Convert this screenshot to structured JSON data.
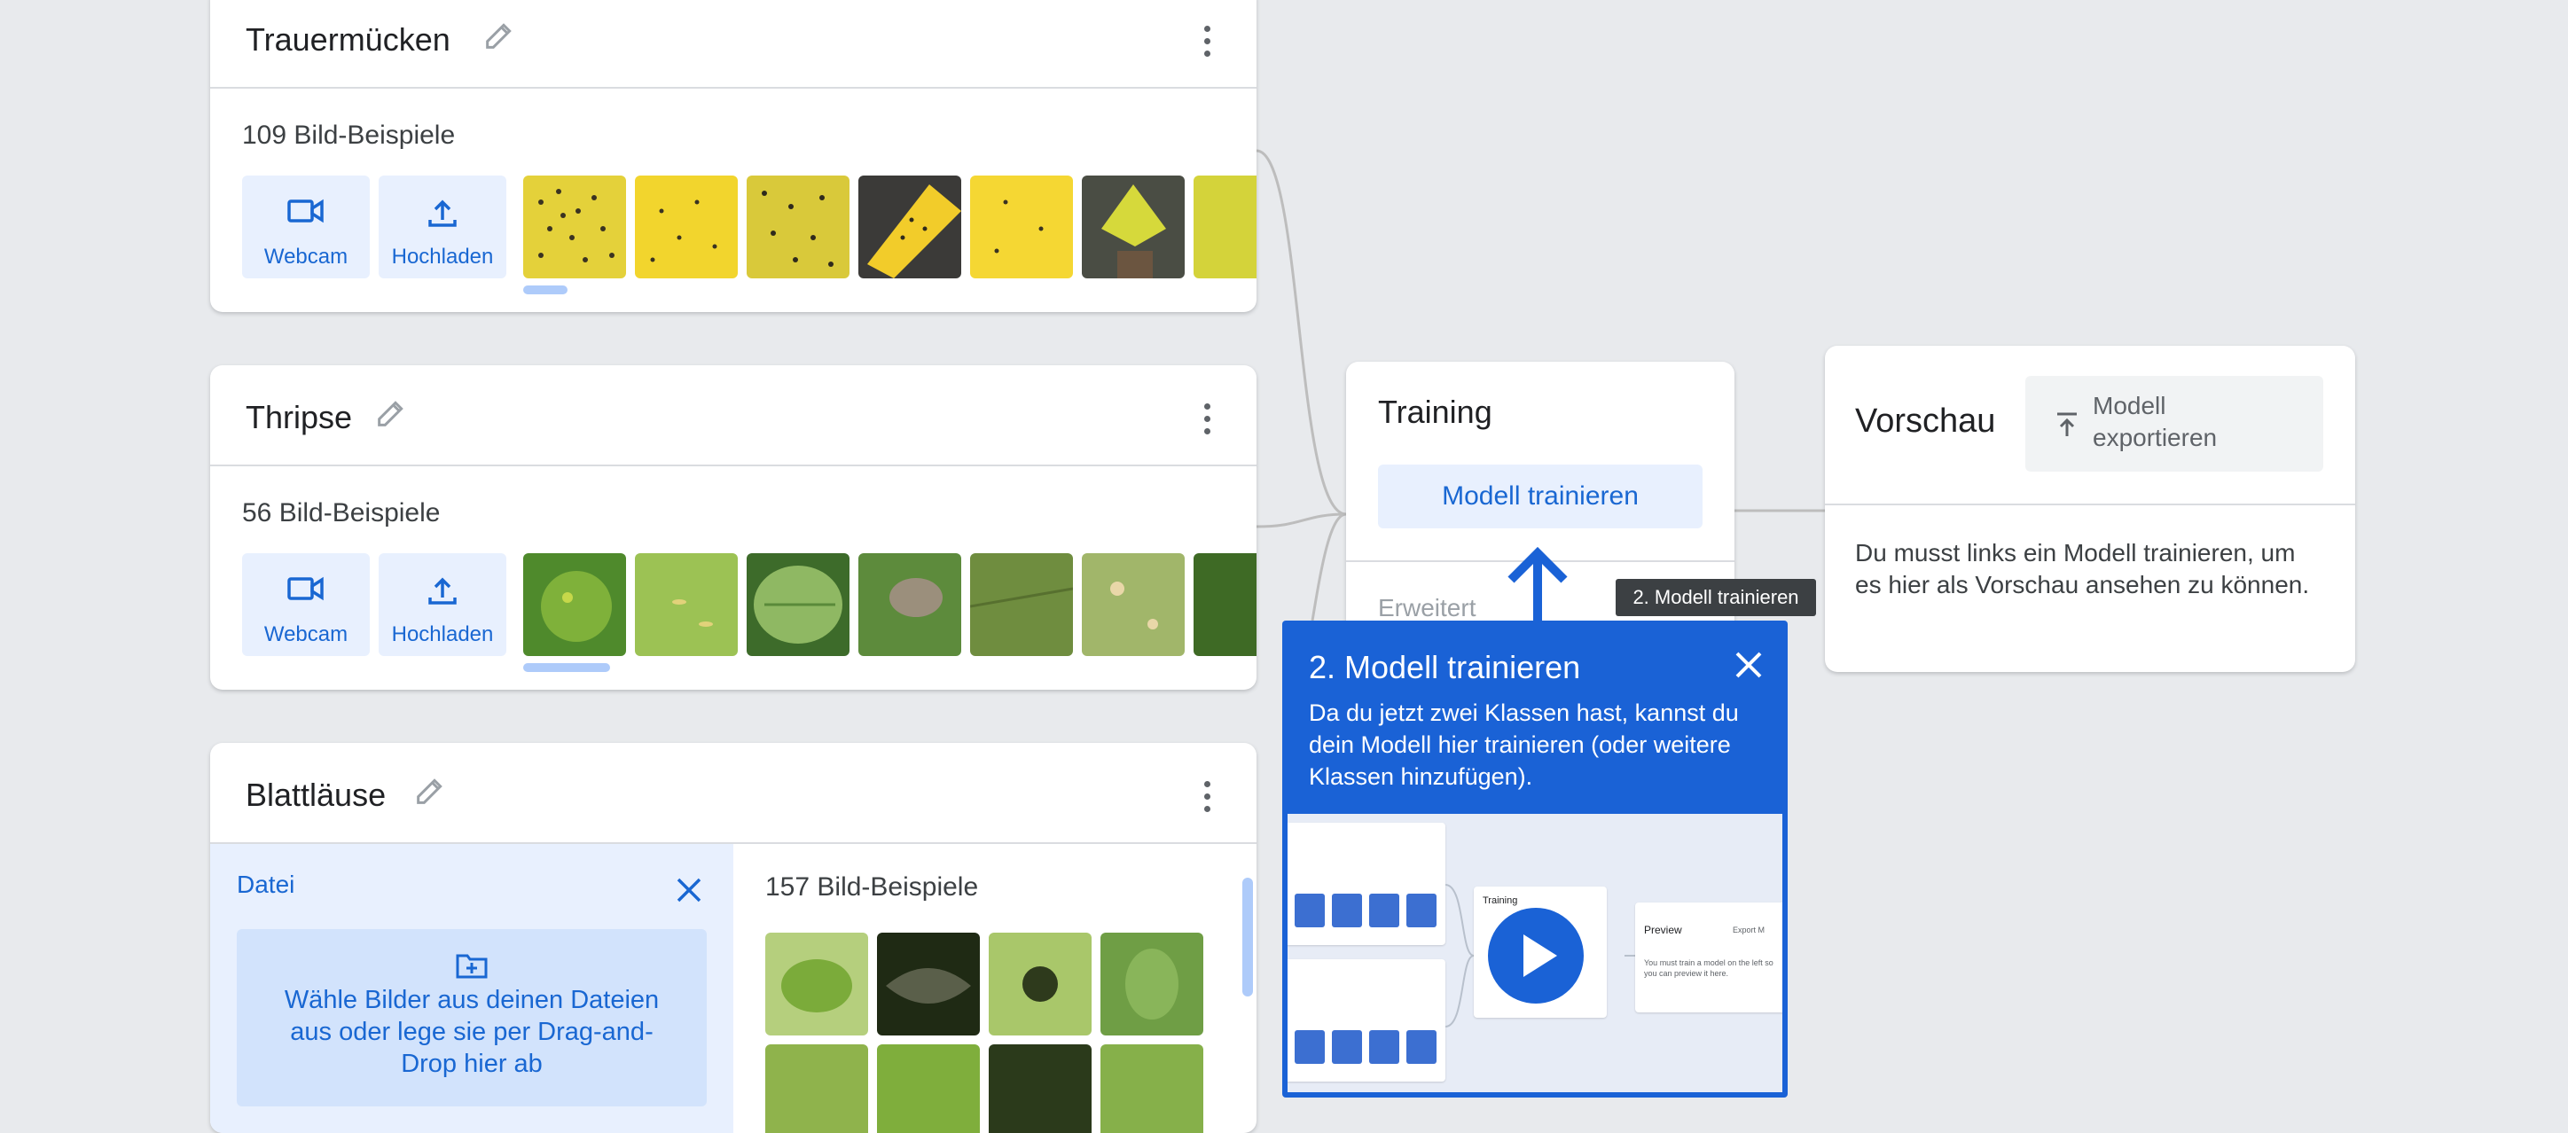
{
  "classes": [
    {
      "name": "Trauermücken",
      "count_label": "109 Bild-Beispiele",
      "webcam_label": "Webcam",
      "upload_label": "Hochladen"
    },
    {
      "name": "Thripse",
      "count_label": "56 Bild-Beispiele",
      "webcam_label": "Webcam",
      "upload_label": "Hochladen"
    },
    {
      "name": "Blattläuse",
      "count_label": "157 Bild-Beispiele",
      "upload_panel": {
        "title": "Datei",
        "dropzone_text": "Wähle Bilder aus deinen Dateien aus oder lege sie per Drag-and-Drop hier ab"
      }
    }
  ],
  "training": {
    "title": "Training",
    "train_button": "Modell trainieren",
    "advanced_label": "Erweitert"
  },
  "preview": {
    "title": "Vorschau",
    "export_button": "Modell exportieren",
    "message": "Du musst links ein Modell trainieren, um es hier als Vorschau ansehen zu können."
  },
  "tooltip": "2. Modell trainieren",
  "coachmark": {
    "title": "2. Modell trainieren",
    "body": "Da du jetzt zwei Klassen hast, kannst du dein Modell hier trainieren (oder weitere Klassen hinzufügen).",
    "video": {
      "training_label": "Training",
      "preview_label": "Preview",
      "export_label": "Export M",
      "preview_hint": "You must train a model on the left so you can preview it here."
    }
  },
  "colors": {
    "accent": "#1a62d6",
    "button_bg": "#e8f0fe",
    "page_bg": "#e8eaed"
  }
}
